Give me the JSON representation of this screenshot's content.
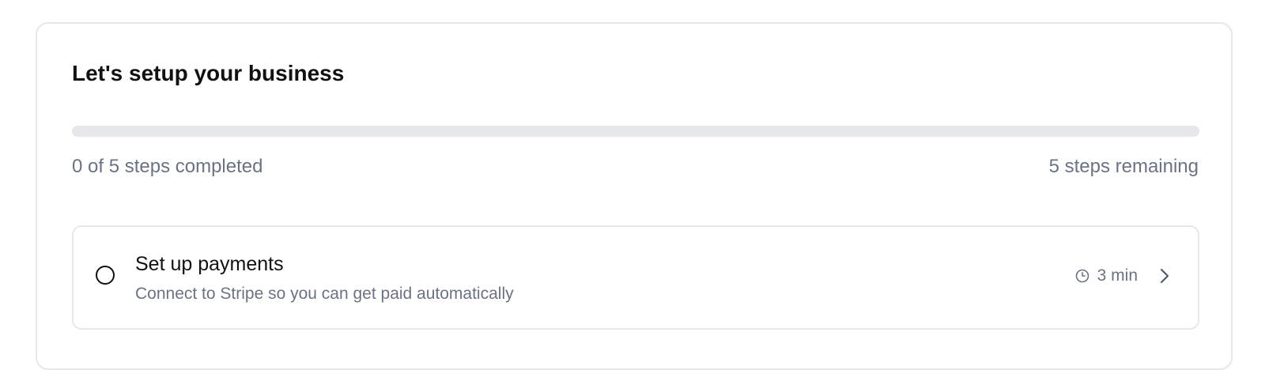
{
  "setup": {
    "title": "Let's setup your business",
    "progress": {
      "completed": 0,
      "total": 5,
      "fraction": 0,
      "completed_text": "0 of 5 steps completed",
      "remaining_text": "5 steps remaining"
    },
    "steps": [
      {
        "title": "Set up payments",
        "description": "Connect to Stripe so you can get paid automatically",
        "time": "3 min",
        "completed": false,
        "icons": [
          "circle-check-icon",
          "clock-icon",
          "chevron-right-icon"
        ]
      }
    ]
  },
  "colors": {
    "text_primary": "#111111",
    "text_muted": "#6b7280",
    "border": "#e5e7eb",
    "track": "#e5e7eb"
  }
}
